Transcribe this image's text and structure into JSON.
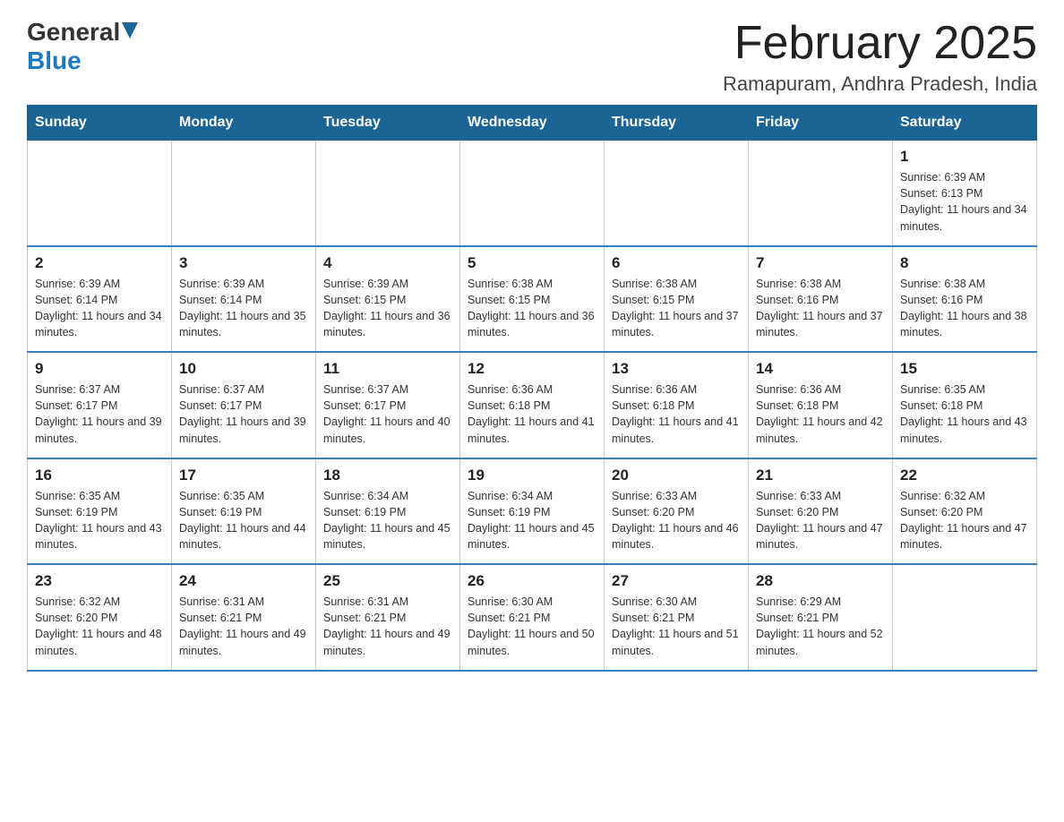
{
  "header": {
    "logo_general": "General",
    "logo_blue": "Blue",
    "month_title": "February 2025",
    "location": "Ramapuram, Andhra Pradesh, India"
  },
  "days_of_week": [
    "Sunday",
    "Monday",
    "Tuesday",
    "Wednesday",
    "Thursday",
    "Friday",
    "Saturday"
  ],
  "weeks": [
    [
      {
        "day": "",
        "info": ""
      },
      {
        "day": "",
        "info": ""
      },
      {
        "day": "",
        "info": ""
      },
      {
        "day": "",
        "info": ""
      },
      {
        "day": "",
        "info": ""
      },
      {
        "day": "",
        "info": ""
      },
      {
        "day": "1",
        "info": "Sunrise: 6:39 AM\nSunset: 6:13 PM\nDaylight: 11 hours and 34 minutes."
      }
    ],
    [
      {
        "day": "2",
        "info": "Sunrise: 6:39 AM\nSunset: 6:14 PM\nDaylight: 11 hours and 34 minutes."
      },
      {
        "day": "3",
        "info": "Sunrise: 6:39 AM\nSunset: 6:14 PM\nDaylight: 11 hours and 35 minutes."
      },
      {
        "day": "4",
        "info": "Sunrise: 6:39 AM\nSunset: 6:15 PM\nDaylight: 11 hours and 36 minutes."
      },
      {
        "day": "5",
        "info": "Sunrise: 6:38 AM\nSunset: 6:15 PM\nDaylight: 11 hours and 36 minutes."
      },
      {
        "day": "6",
        "info": "Sunrise: 6:38 AM\nSunset: 6:15 PM\nDaylight: 11 hours and 37 minutes."
      },
      {
        "day": "7",
        "info": "Sunrise: 6:38 AM\nSunset: 6:16 PM\nDaylight: 11 hours and 37 minutes."
      },
      {
        "day": "8",
        "info": "Sunrise: 6:38 AM\nSunset: 6:16 PM\nDaylight: 11 hours and 38 minutes."
      }
    ],
    [
      {
        "day": "9",
        "info": "Sunrise: 6:37 AM\nSunset: 6:17 PM\nDaylight: 11 hours and 39 minutes."
      },
      {
        "day": "10",
        "info": "Sunrise: 6:37 AM\nSunset: 6:17 PM\nDaylight: 11 hours and 39 minutes."
      },
      {
        "day": "11",
        "info": "Sunrise: 6:37 AM\nSunset: 6:17 PM\nDaylight: 11 hours and 40 minutes."
      },
      {
        "day": "12",
        "info": "Sunrise: 6:36 AM\nSunset: 6:18 PM\nDaylight: 11 hours and 41 minutes."
      },
      {
        "day": "13",
        "info": "Sunrise: 6:36 AM\nSunset: 6:18 PM\nDaylight: 11 hours and 41 minutes."
      },
      {
        "day": "14",
        "info": "Sunrise: 6:36 AM\nSunset: 6:18 PM\nDaylight: 11 hours and 42 minutes."
      },
      {
        "day": "15",
        "info": "Sunrise: 6:35 AM\nSunset: 6:18 PM\nDaylight: 11 hours and 43 minutes."
      }
    ],
    [
      {
        "day": "16",
        "info": "Sunrise: 6:35 AM\nSunset: 6:19 PM\nDaylight: 11 hours and 43 minutes."
      },
      {
        "day": "17",
        "info": "Sunrise: 6:35 AM\nSunset: 6:19 PM\nDaylight: 11 hours and 44 minutes."
      },
      {
        "day": "18",
        "info": "Sunrise: 6:34 AM\nSunset: 6:19 PM\nDaylight: 11 hours and 45 minutes."
      },
      {
        "day": "19",
        "info": "Sunrise: 6:34 AM\nSunset: 6:19 PM\nDaylight: 11 hours and 45 minutes."
      },
      {
        "day": "20",
        "info": "Sunrise: 6:33 AM\nSunset: 6:20 PM\nDaylight: 11 hours and 46 minutes."
      },
      {
        "day": "21",
        "info": "Sunrise: 6:33 AM\nSunset: 6:20 PM\nDaylight: 11 hours and 47 minutes."
      },
      {
        "day": "22",
        "info": "Sunrise: 6:32 AM\nSunset: 6:20 PM\nDaylight: 11 hours and 47 minutes."
      }
    ],
    [
      {
        "day": "23",
        "info": "Sunrise: 6:32 AM\nSunset: 6:20 PM\nDaylight: 11 hours and 48 minutes."
      },
      {
        "day": "24",
        "info": "Sunrise: 6:31 AM\nSunset: 6:21 PM\nDaylight: 11 hours and 49 minutes."
      },
      {
        "day": "25",
        "info": "Sunrise: 6:31 AM\nSunset: 6:21 PM\nDaylight: 11 hours and 49 minutes."
      },
      {
        "day": "26",
        "info": "Sunrise: 6:30 AM\nSunset: 6:21 PM\nDaylight: 11 hours and 50 minutes."
      },
      {
        "day": "27",
        "info": "Sunrise: 6:30 AM\nSunset: 6:21 PM\nDaylight: 11 hours and 51 minutes."
      },
      {
        "day": "28",
        "info": "Sunrise: 6:29 AM\nSunset: 6:21 PM\nDaylight: 11 hours and 52 minutes."
      },
      {
        "day": "",
        "info": ""
      }
    ]
  ]
}
